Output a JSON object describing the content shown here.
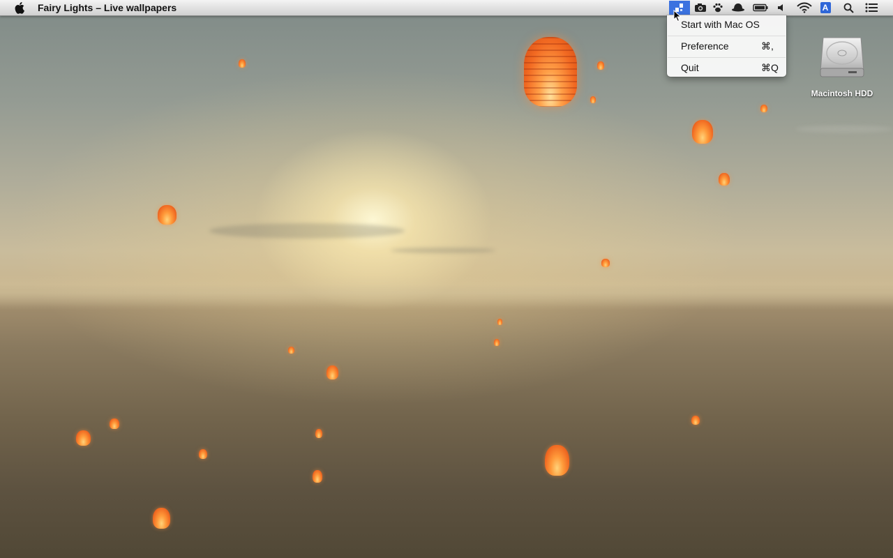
{
  "menubar": {
    "app_title": "Fairy Lights – Live wallpapers",
    "apple_icon": "apple-logo-icon",
    "status_icons": [
      "fairy-lights-icon",
      "camera-icon",
      "paw-icon",
      "hat-icon",
      "battery-icon",
      "volume-icon",
      "wifi-icon",
      "input-source-icon",
      "spotlight-search-icon",
      "notification-center-icon"
    ],
    "input_source_letter": "A"
  },
  "dropdown": {
    "items": [
      {
        "label": "Start with Mac OS",
        "shortcut": ""
      },
      {
        "label": "Preference",
        "shortcut": "⌘,"
      },
      {
        "label": "Quit",
        "shortcut": "⌘Q"
      }
    ]
  },
  "desktop": {
    "hdd_label": "Macintosh HDD"
  },
  "colors": {
    "menu_highlight": "#3b72e0",
    "lantern": "#f06a22"
  }
}
